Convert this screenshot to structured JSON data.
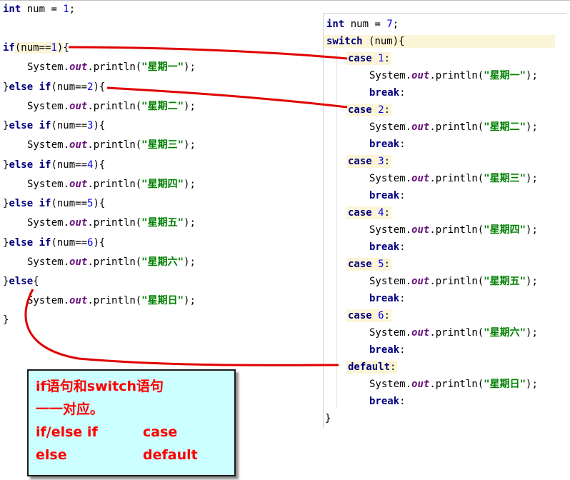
{
  "left_code": {
    "line_init": {
      "type": "int",
      "name": "num",
      "op": "=",
      "value": "1",
      "end": ";"
    },
    "if_kw": "if",
    "else_kw": "else",
    "cond_prefix": "(num==",
    "cond_suffix": ")",
    "open_brace": "{",
    "close_brace": "}",
    "println_prefix": "System.",
    "println_field": "out",
    "println_method": ".println(",
    "println_close": ");",
    "branches": [
      {
        "num": "1",
        "text": "\"星期一\""
      },
      {
        "num": "2",
        "text": "\"星期二\""
      },
      {
        "num": "3",
        "text": "\"星期三\""
      },
      {
        "num": "4",
        "text": "\"星期四\""
      },
      {
        "num": "5",
        "text": "\"星期五\""
      },
      {
        "num": "6",
        "text": "\"星期六\""
      }
    ],
    "else_text": "\"星期日\""
  },
  "right_code": {
    "line_init": {
      "type": "int",
      "name": "num",
      "op": "=",
      "value": "7",
      "end": ";"
    },
    "switch_kw": "switch",
    "switch_arg": "(num){",
    "case_kw": "case",
    "break_kw": "break",
    "colon": ":",
    "default_kw": "default",
    "cases": [
      {
        "num": "1",
        "text": "\"星期一\""
      },
      {
        "num": "2",
        "text": "\"星期二\""
      },
      {
        "num": "3",
        "text": "\"星期三\""
      },
      {
        "num": "4",
        "text": "\"星期四\""
      },
      {
        "num": "5",
        "text": "\"星期五\""
      },
      {
        "num": "6",
        "text": "\"星期六\""
      }
    ],
    "default_text": "\"星期日\"",
    "close_brace": "}"
  },
  "callout": {
    "line1": "if语句和switch语句",
    "line2": "一一对应。",
    "line3_left": "if/else if",
    "line3_right": "case",
    "line4_left": "else",
    "line4_right": "default"
  },
  "colors": {
    "keyword": "#000080",
    "number": "#0000ff",
    "field": "#660e7a",
    "string": "#008000",
    "arrow": "#e00000",
    "callout_bg": "#ccffff",
    "callout_text": "#ff0000"
  }
}
